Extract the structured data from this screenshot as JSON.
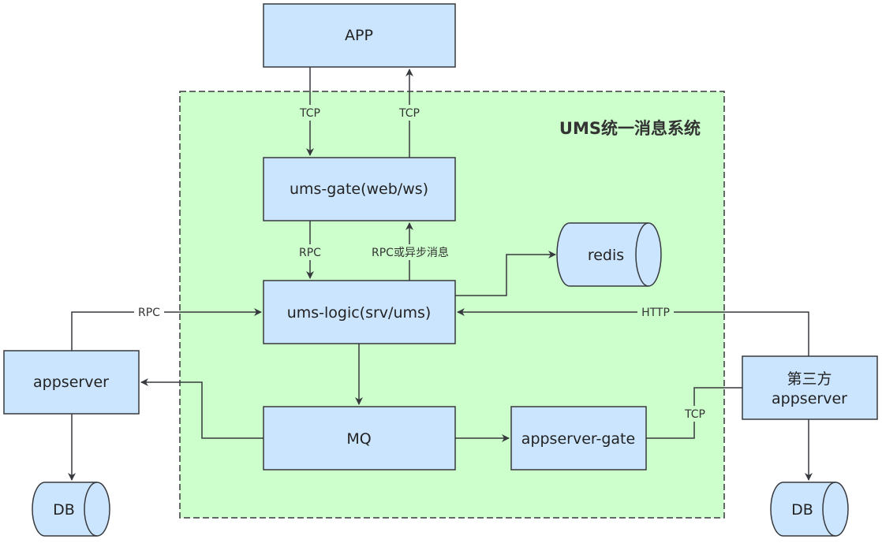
{
  "group": {
    "title": "UMS统一消息系统"
  },
  "nodes": {
    "app": "APP",
    "ums_gate": "ums-gate(web/ws)",
    "redis": "redis",
    "ums_logic": "ums-logic(srv/ums)",
    "appserver": "appserver",
    "third_party_line1": "第三方",
    "third_party_line2": "appserver",
    "mq": "MQ",
    "appserver_gate": "appserver-gate",
    "db_left": "DB",
    "db_right": "DB"
  },
  "edges": {
    "app_to_gate": "TCP",
    "gate_to_app": "TCP",
    "gate_to_logic": "RPC",
    "logic_to_gate": "RPC或异步消息",
    "appserver_to_logic": "RPC",
    "third_to_logic": "HTTP",
    "gate_to_third": "TCP"
  },
  "colors": {
    "box_fill": "#cce5ff",
    "group_fill": "#ccffcc",
    "stroke": "#36393d"
  }
}
